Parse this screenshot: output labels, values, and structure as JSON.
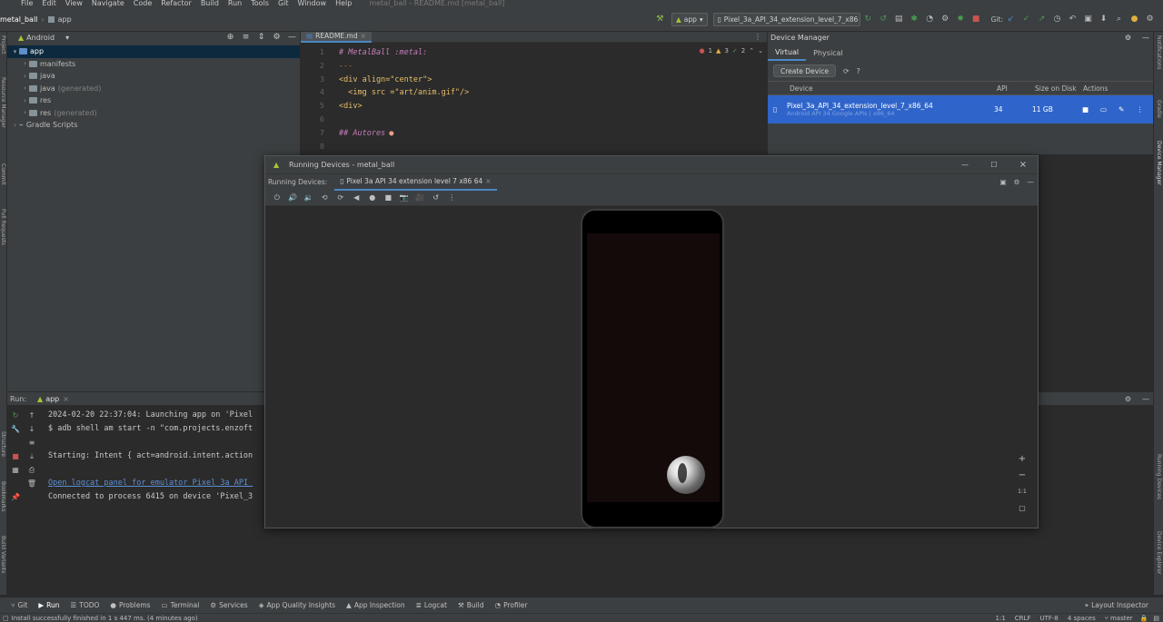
{
  "window_title": "metal_ball - README.md [metal_ball]",
  "menu": [
    "File",
    "Edit",
    "View",
    "Navigate",
    "Code",
    "Refactor",
    "Build",
    "Run",
    "Tools",
    "Git",
    "Window",
    "Help"
  ],
  "breadcrumb": {
    "project": "metal_ball",
    "module": "app"
  },
  "toolbar": {
    "run_config": "app",
    "device": "Pixel_3a_API_34_extension_level_7_x86",
    "git_label": "Git:"
  },
  "project_panel": {
    "view": "Android",
    "items": [
      {
        "label": "app",
        "depth": 0,
        "expanded": true,
        "selected": true
      },
      {
        "label": "manifests",
        "depth": 1
      },
      {
        "label": "java",
        "depth": 1
      },
      {
        "label": "java",
        "suffix": "(generated)",
        "depth": 1
      },
      {
        "label": "res",
        "depth": 1
      },
      {
        "label": "res",
        "suffix": "(generated)",
        "depth": 1
      },
      {
        "label": "Gradle Scripts",
        "depth": 0
      }
    ]
  },
  "editor": {
    "tab": "README.md",
    "inspections": {
      "errors": "1",
      "warnings": "3",
      "weak": "2"
    },
    "line_numbers": [
      "1",
      "2",
      "3",
      "4",
      "5",
      "6",
      "7",
      "8"
    ],
    "lines": [
      "# MetalBall :metal:",
      "---",
      "<div align=\"center\">",
      "  <img src =\"art/anim.gif\"/>",
      "<div>",
      "",
      "## Autores",
      ""
    ]
  },
  "device_manager": {
    "title": "Device Manager",
    "tabs": [
      "Virtual",
      "Physical"
    ],
    "create_button": "Create Device",
    "columns": [
      "Device",
      "API",
      "Size on Disk",
      "Actions"
    ],
    "device": {
      "name": "Pixel_3a_API_34_extension_level_7_x86_64",
      "subtitle": "Android API 34 Google APIs | x86_64",
      "api": "34",
      "size": "11 GB"
    }
  },
  "running_devices": {
    "title": "Running Devices - metal_ball",
    "label": "Running Devices:",
    "tab": "Pixel 3a API 34 extension level 7 x86 64",
    "zoom_fit": "1:1"
  },
  "run_panel": {
    "label": "Run:",
    "config": "app",
    "console": [
      {
        "text": "2024-02-20 22:37:04: Launching app on 'Pixel",
        "link": false
      },
      {
        "text": "$ adb shell am start -n \"com.projects.enzoft",
        "link": false
      },
      {
        "text": "",
        "link": false
      },
      {
        "text": "Starting: Intent { act=android.intent.action",
        "link": false
      },
      {
        "text": "",
        "link": false
      },
      {
        "text": "Open logcat panel for emulator Pixel 3a API ",
        "link": true
      },
      {
        "text": "Connected to process 6415 on device 'Pixel_3",
        "link": false
      }
    ]
  },
  "bottom_tabs": [
    "Git",
    "Run",
    "TODO",
    "Problems",
    "Terminal",
    "Services",
    "App Quality Insights",
    "App Inspection",
    "Logcat",
    "Build",
    "Profiler"
  ],
  "layout_inspector": "Layout Inspector",
  "status": {
    "message": "Install successfully finished in 1 s 447 ms. (4 minutes ago)",
    "position": "1:1",
    "line_sep": "CRLF",
    "encoding": "UTF-8",
    "indent": "4 spaces",
    "branch": "master"
  },
  "side_tools": {
    "left": [
      "Project",
      "Resource Manager",
      "Commit",
      "Pull Requests",
      "Structure",
      "Bookmarks",
      "Build Variants"
    ],
    "right": [
      "Notifications",
      "Gradle",
      "Device Manager",
      "Running Devices",
      "Device Explorer"
    ]
  },
  "colors": {
    "accent": "#4a88c7",
    "selection": "#2f65ca",
    "android_green": "#a4c639"
  }
}
